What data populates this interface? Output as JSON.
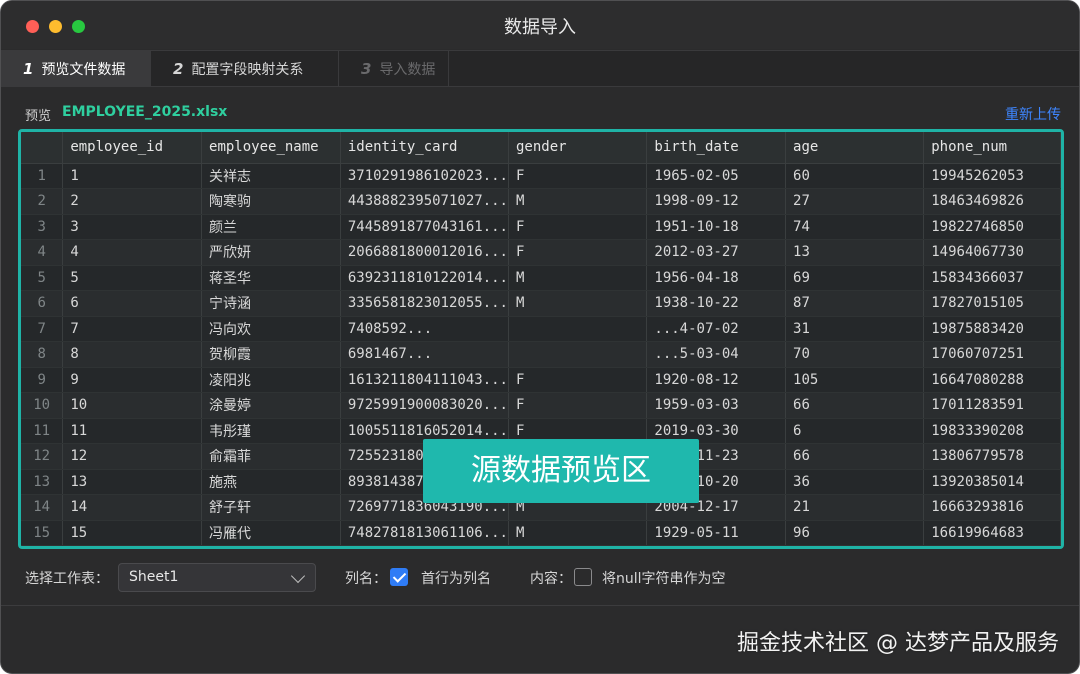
{
  "window": {
    "title": "数据导入"
  },
  "tabs": [
    {
      "num": "1",
      "label": "预览文件数据"
    },
    {
      "num": "2",
      "label": "配置字段映射关系"
    },
    {
      "num": "3",
      "label": "导入数据"
    }
  ],
  "preview": {
    "label": "预览",
    "file_name": "EMPLOYEE_2025.xlsx",
    "reupload": "重新上传"
  },
  "table": {
    "columns": [
      "employee_id",
      "employee_name",
      "identity_card",
      "gender",
      "birth_date",
      "age",
      "phone_num"
    ],
    "rows": [
      [
        "1",
        "1",
        "关祥志",
        "3710291986102023...",
        "F",
        "1965-02-05",
        "60",
        "19945262053"
      ],
      [
        "2",
        "2",
        "陶寒驹",
        "4438882395071027...",
        "M",
        "1998-09-12",
        "27",
        "18463469826"
      ],
      [
        "3",
        "3",
        "颜兰",
        "7445891877043161...",
        "F",
        "1951-10-18",
        "74",
        "19822746850"
      ],
      [
        "4",
        "4",
        "严欣妍",
        "2066881800012016...",
        "F",
        "2012-03-27",
        "13",
        "14964067730"
      ],
      [
        "5",
        "5",
        "蒋圣华",
        "6392311810122014...",
        "M",
        "1956-04-18",
        "69",
        "15834366037"
      ],
      [
        "6",
        "6",
        "宁诗涵",
        "3356581823012055...",
        "M",
        "1938-10-22",
        "87",
        "17827015105"
      ],
      [
        "7",
        "7",
        "冯向欢",
        "7408592...",
        "",
        "...4-07-02",
        "31",
        "19875883420"
      ],
      [
        "8",
        "8",
        "贺柳霞",
        "6981467...",
        "",
        "...5-03-04",
        "70",
        "17060707251"
      ],
      [
        "9",
        "9",
        "凌阳兆",
        "1613211804111043...",
        "F",
        "1920-08-12",
        "105",
        "16647080288"
      ],
      [
        "10",
        "10",
        "涂曼婷",
        "9725991900083020...",
        "F",
        "1959-03-03",
        "66",
        "17011283591"
      ],
      [
        "11",
        "11",
        "韦彤瑾",
        "1005511816052014...",
        "F",
        "2019-03-30",
        "6",
        "19833390208"
      ],
      [
        "12",
        "12",
        "俞霜菲",
        "7255231803093166...",
        "M",
        "1959-11-23",
        "66",
        "13806779578"
      ],
      [
        "13",
        "13",
        "施燕",
        "8938143873011677...",
        "M",
        "1989-10-20",
        "36",
        "13920385014"
      ],
      [
        "14",
        "14",
        "舒子轩",
        "7269771836043190...",
        "M",
        "2004-12-17",
        "21",
        "16663293816"
      ],
      [
        "15",
        "15",
        "冯雁代",
        "7482781813061106...",
        "M",
        "1929-05-11",
        "96",
        "16619964683"
      ]
    ]
  },
  "overlay": {
    "text": "源数据预览区"
  },
  "options": {
    "sheet_label": "选择工作表：",
    "sheet_value": "Sheet1",
    "colname_label": "列名：",
    "colname_checkbox_label": "首行为列名",
    "content_label": "内容：",
    "null_checkbox_label": "将null字符串作为空"
  },
  "watermark": "掘金技术社区 @ 达梦产品及服务",
  "colors": {
    "accent_teal": "#1fb8ad",
    "link_blue": "#3e86ff",
    "file_green": "#2fcf9f"
  }
}
